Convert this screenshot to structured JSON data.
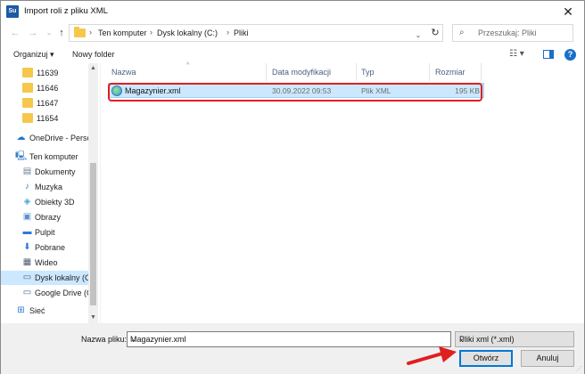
{
  "window": {
    "app_icon": "Su",
    "title": "Import roli z pliku XML",
    "close_glyph": "✕"
  },
  "nav": {
    "back_glyph": "←",
    "forward_glyph": "→",
    "recent_glyph": "⌄",
    "up_glyph": "↑"
  },
  "address": {
    "sep_glyph": "›",
    "crumbs": [
      "Ten komputer",
      "Dysk lokalny (C:)",
      "Pliki"
    ],
    "dropdown_glyph": "⌄",
    "refresh_glyph": "↻"
  },
  "search": {
    "icon_glyph": "⌕",
    "placeholder": "Przeszukaj: Pliki"
  },
  "toolbar": {
    "organize_label": "Organizuj ▾",
    "new_folder_label": "Nowy folder",
    "view_glyph": "☷ ▾",
    "help_glyph": "?"
  },
  "sidebar": {
    "items": [
      {
        "label": "11639",
        "icon": "folder-icon"
      },
      {
        "label": "11646",
        "icon": "folder-icon"
      },
      {
        "label": "11647",
        "icon": "folder-icon"
      },
      {
        "label": "11654",
        "icon": "folder-icon"
      },
      {
        "label": "OneDrive - Persor",
        "icon": "cloud-icon",
        "glyph": "☁"
      },
      {
        "label": "Ten komputer",
        "icon": "computer-icon",
        "glyph": "🖳"
      },
      {
        "label": "Dokumenty",
        "icon": "documents-icon",
        "glyph": "▤"
      },
      {
        "label": "Muzyka",
        "icon": "music-icon",
        "glyph": "♪"
      },
      {
        "label": "Obiekty 3D",
        "icon": "objects-3d-icon",
        "glyph": "◈"
      },
      {
        "label": "Obrazy",
        "icon": "pictures-icon",
        "glyph": "▣"
      },
      {
        "label": "Pulpit",
        "icon": "desktop-icon",
        "glyph": "▬"
      },
      {
        "label": "Pobrane",
        "icon": "downloads-icon",
        "glyph": "⬇"
      },
      {
        "label": "Wideo",
        "icon": "video-icon",
        "glyph": "▦"
      },
      {
        "label": "Dysk lokalny (C:)",
        "icon": "drive-icon",
        "glyph": "▭"
      },
      {
        "label": "Google Drive (G:",
        "icon": "drive-icon",
        "glyph": "▭"
      },
      {
        "label": "Sieć",
        "icon": "network-icon",
        "glyph": "⊞"
      }
    ],
    "scroll_up_glyph": "▲",
    "scroll_down_glyph": "▼"
  },
  "columns": {
    "name": "Nazwa",
    "date": "Data modyfikacji",
    "type": "Typ",
    "size": "Rozmiar",
    "sort_glyph": "^"
  },
  "files": [
    {
      "name": "Magazynier.xml",
      "date": "30.09.2022 09:53",
      "type": "Plik XML",
      "size": "195 KB"
    }
  ],
  "footer": {
    "filename_label": "Nazwa pliku:",
    "filename_value": "Magazynier.xml",
    "filename_dd_glyph": "⌄",
    "filetype_value": "Pliki xml (*.xml)",
    "filetype_dd_glyph": "⌄",
    "open_label": "Otwórz",
    "cancel_label": "Anuluj",
    "grip_glyph": "⋰"
  },
  "colors": {
    "selection": "#cce8ff",
    "highlight_box": "#e01f1f",
    "arrow": "#e01f1f",
    "folder": "#f5c84c",
    "accent": "#0078d7"
  }
}
